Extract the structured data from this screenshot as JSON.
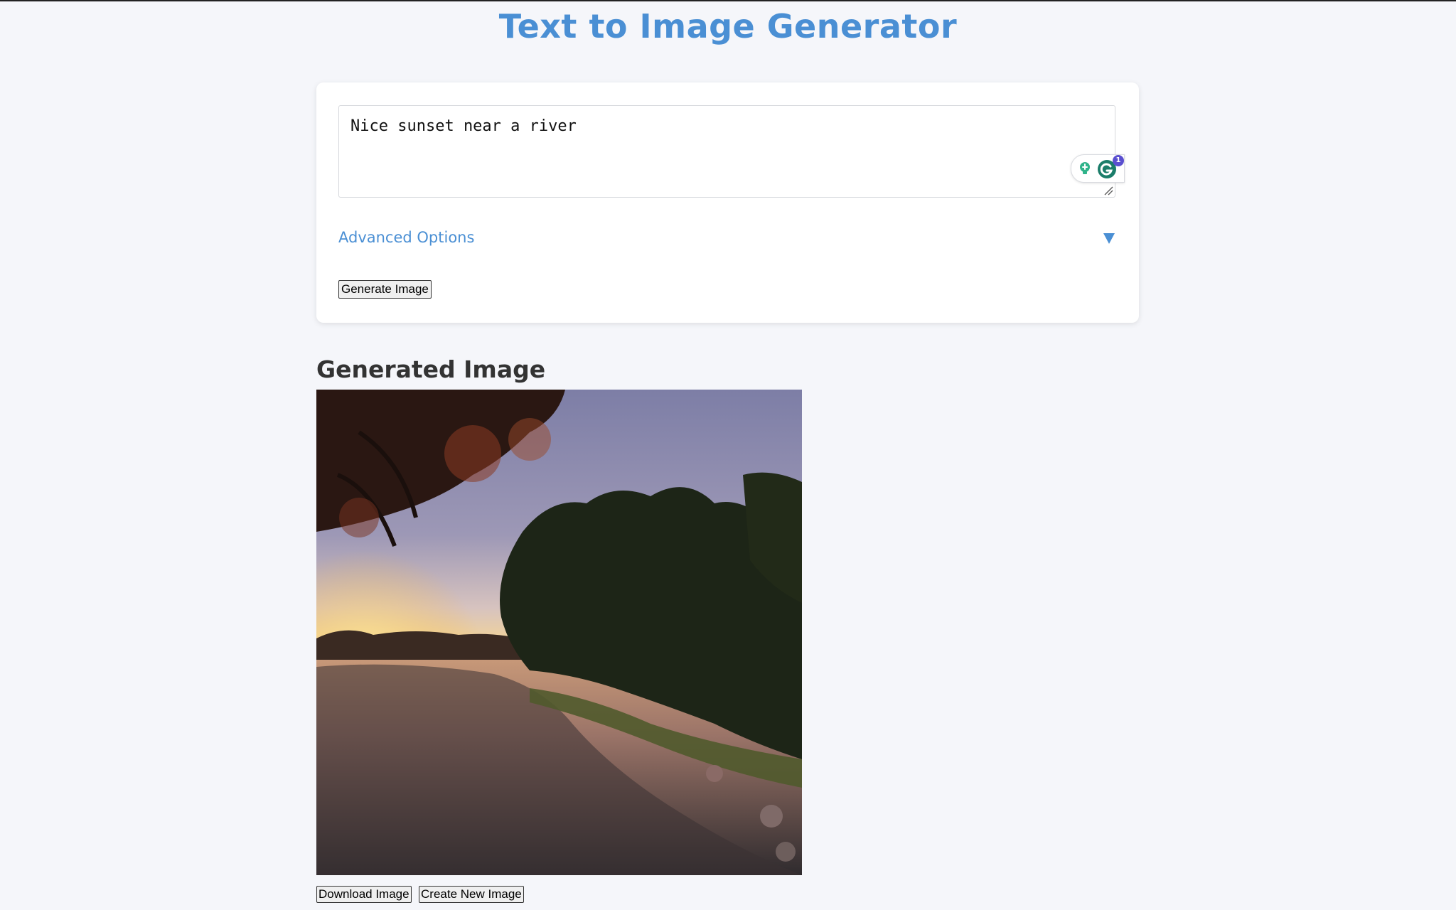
{
  "header": {
    "title": "Text to Image Generator"
  },
  "form": {
    "prompt_value": "Nice sunset near a river",
    "advanced_label": "Advanced Options",
    "generate_label": "Generate Image",
    "grammar_badge_count": "1"
  },
  "result": {
    "heading": "Generated Image",
    "image_alt": "Sunset over a river with trees silhouetted",
    "download_label": "Download Image",
    "new_label": "Create New Image"
  },
  "colors": {
    "accent": "#4a8fd4",
    "background": "#f5f6fa",
    "card": "#ffffff"
  },
  "icons": [
    "lightbulb-icon",
    "grammarly-icon",
    "resize-grip-icon",
    "triangle-down-icon"
  ]
}
